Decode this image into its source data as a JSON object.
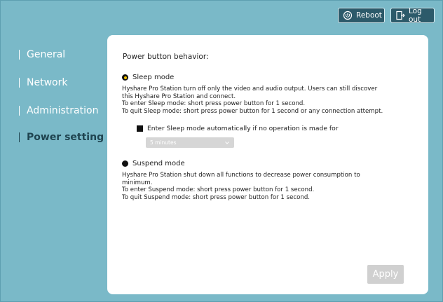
{
  "header": {
    "reboot_label": "Reboot",
    "reboot_icon": "power-cycle-icon",
    "logout_label": "Log out",
    "logout_icon": "logout-door-icon"
  },
  "sidebar": {
    "items": [
      {
        "label": "General",
        "active": false
      },
      {
        "label": "Network",
        "active": false
      },
      {
        "label": "Administration",
        "active": false
      },
      {
        "label": "Power setting",
        "active": true
      }
    ]
  },
  "panel": {
    "heading": "Power button behavior:",
    "sleep": {
      "label": "Sleep mode",
      "selected": true,
      "lines": [
        "Hyshare Pro Station turn off only the video and audio output. Users can still discover",
        "this Hyshare Pro Station and connect.",
        "To enter Sleep mode: short press power button for 1 second.",
        "To quit Sleep mode: short press power button for 1 second or any connection attempt."
      ],
      "auto_label": "Enter Sleep mode automatically if no operation is made for",
      "auto_checked": true,
      "timeout_value": "5 minutes"
    },
    "suspend": {
      "label": "Suspend mode",
      "selected": false,
      "lines": [
        "Hyshare Pro Station shut down all functions to decrease power consumption to",
        "minimum.",
        "To enter Suspend mode: short press power button for 1 second.",
        "To quit Suspend mode: short press power button for 1 second."
      ]
    },
    "apply_label": "Apply"
  },
  "colors": {
    "background": "#7ab9c8",
    "button_dark": "#2c5a6a",
    "active_nav": "#1f4450",
    "radio_dot": "#f2c200"
  }
}
